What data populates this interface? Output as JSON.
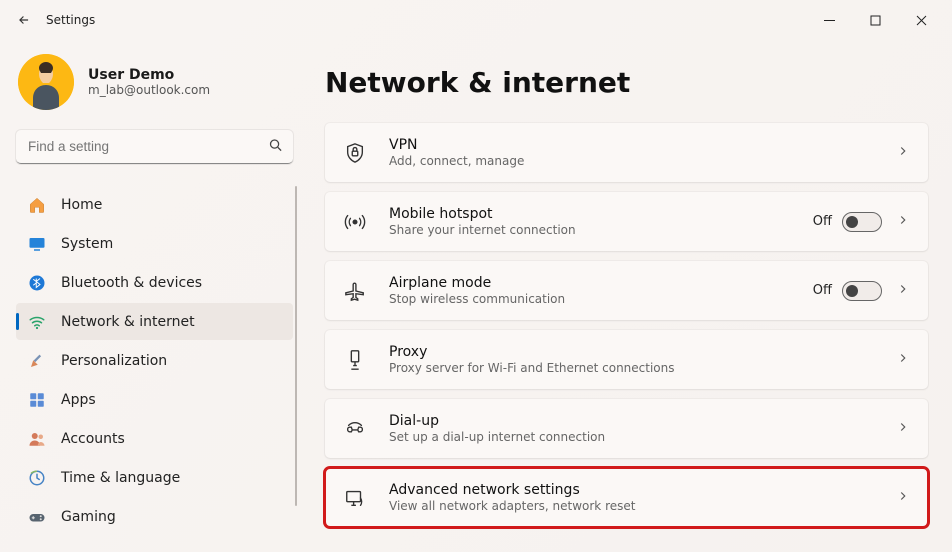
{
  "window": {
    "title": "Settings"
  },
  "profile": {
    "name": "User Demo",
    "email": "m_lab@outlook.com"
  },
  "search": {
    "placeholder": "Find a setting"
  },
  "sidebar": {
    "items": [
      {
        "id": "home",
        "label": "Home",
        "active": false
      },
      {
        "id": "system",
        "label": "System",
        "active": false
      },
      {
        "id": "bluetooth",
        "label": "Bluetooth & devices",
        "active": false
      },
      {
        "id": "network",
        "label": "Network & internet",
        "active": true
      },
      {
        "id": "personalization",
        "label": "Personalization",
        "active": false
      },
      {
        "id": "apps",
        "label": "Apps",
        "active": false
      },
      {
        "id": "accounts",
        "label": "Accounts",
        "active": false
      },
      {
        "id": "time",
        "label": "Time & language",
        "active": false
      },
      {
        "id": "gaming",
        "label": "Gaming",
        "active": false
      }
    ]
  },
  "page": {
    "title": "Network & internet",
    "items": [
      {
        "id": "vpn",
        "title": "VPN",
        "subtitle": "Add, connect, manage",
        "toggle": null
      },
      {
        "id": "hotspot",
        "title": "Mobile hotspot",
        "subtitle": "Share your internet connection",
        "toggle": "Off"
      },
      {
        "id": "airplane",
        "title": "Airplane mode",
        "subtitle": "Stop wireless communication",
        "toggle": "Off"
      },
      {
        "id": "proxy",
        "title": "Proxy",
        "subtitle": "Proxy server for Wi-Fi and Ethernet connections",
        "toggle": null
      },
      {
        "id": "dialup",
        "title": "Dial-up",
        "subtitle": "Set up a dial-up internet connection",
        "toggle": null
      },
      {
        "id": "advanced",
        "title": "Advanced network settings",
        "subtitle": "View all network adapters, network reset",
        "toggle": null,
        "highlighted": true
      }
    ]
  }
}
